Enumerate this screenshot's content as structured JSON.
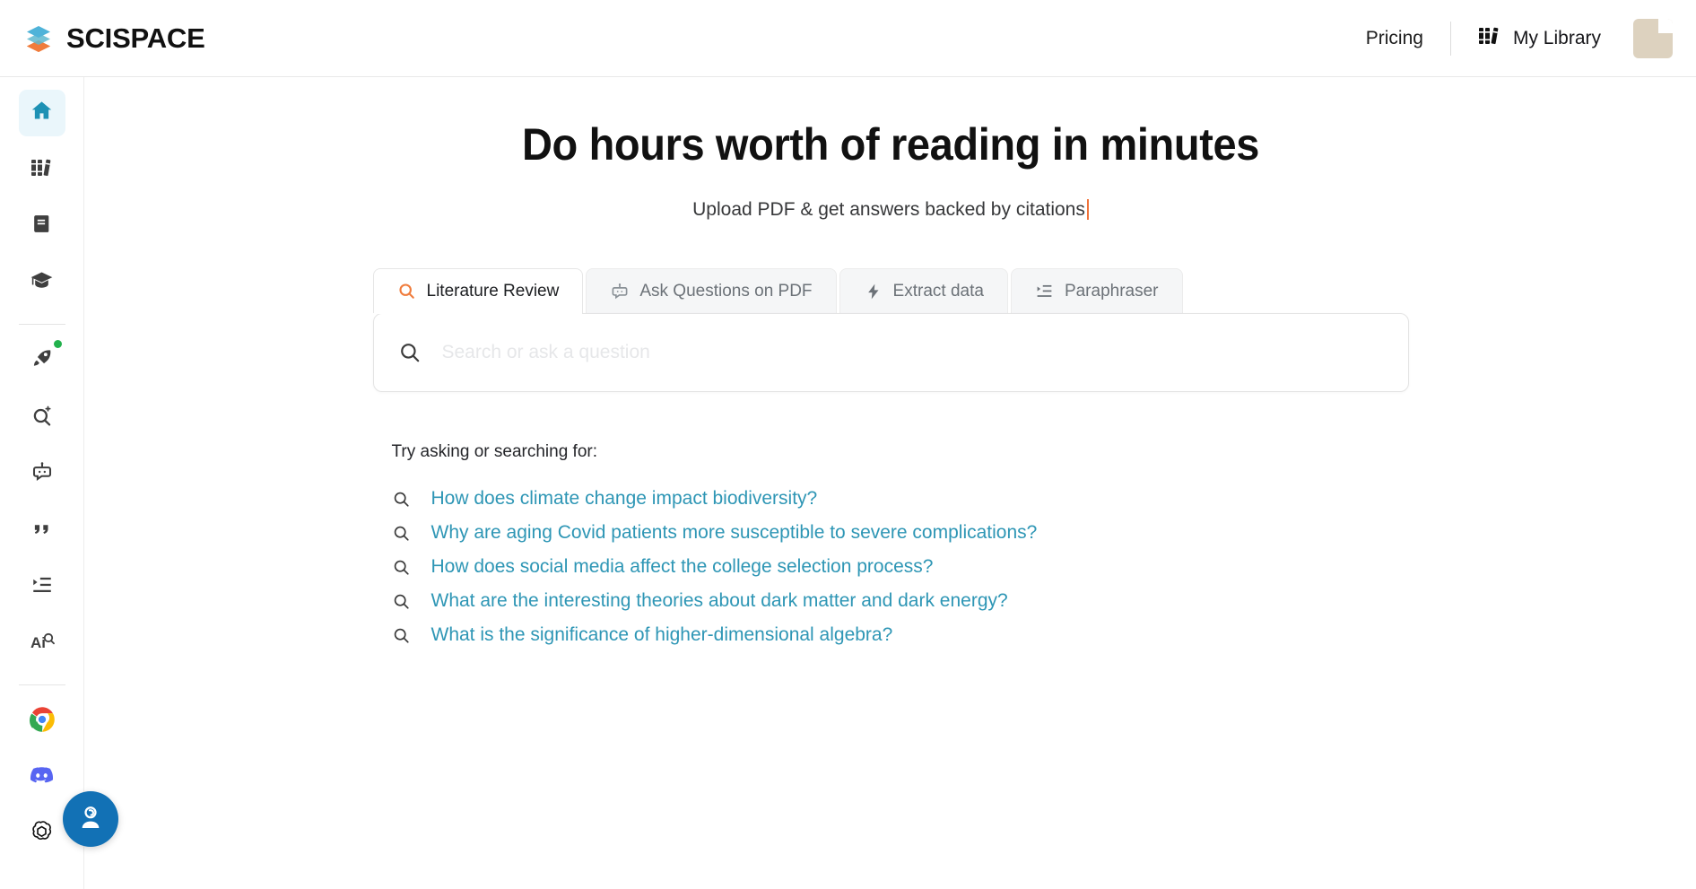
{
  "header": {
    "brand_name": "SCISPACE",
    "logo_icon": "layers-stack-icon",
    "pricing_label": "Pricing",
    "library_label": "My Library",
    "library_icon": "books-icon",
    "avatar_icon": "user-avatar",
    "avatar_color": "#ddd2bf"
  },
  "sidebar": {
    "items": [
      {
        "name": "home",
        "icon": "home-icon",
        "active": true,
        "badge": false
      },
      {
        "name": "library",
        "icon": "books-icon",
        "active": false,
        "badge": false
      },
      {
        "name": "notebook",
        "icon": "book-icon",
        "active": false,
        "badge": false
      },
      {
        "name": "scholar",
        "icon": "graduation-cap-icon",
        "active": false,
        "badge": false
      },
      {
        "name": "divider",
        "icon": "divider",
        "active": false,
        "badge": false
      },
      {
        "name": "launch",
        "icon": "rocket-icon",
        "active": false,
        "badge": true
      },
      {
        "name": "ai-search",
        "icon": "magnifier-sparkle-icon",
        "active": false,
        "badge": false
      },
      {
        "name": "chatbot",
        "icon": "chat-bot-icon",
        "active": false,
        "badge": false
      },
      {
        "name": "citation",
        "icon": "quote-icon",
        "active": false,
        "badge": false
      },
      {
        "name": "paraphraser",
        "icon": "indent-list-icon",
        "active": false,
        "badge": false
      },
      {
        "name": "ai-detector",
        "icon": "ai-detect-icon",
        "active": false,
        "badge": false
      },
      {
        "name": "divider2",
        "icon": "divider",
        "active": false,
        "badge": false
      },
      {
        "name": "chrome-extension",
        "icon": "chrome-icon",
        "active": false,
        "badge": false
      },
      {
        "name": "discord",
        "icon": "discord-icon",
        "active": false,
        "badge": false
      },
      {
        "name": "openai",
        "icon": "openai-icon",
        "active": false,
        "badge": false
      }
    ],
    "active_color": "#1d91b4",
    "active_bg": "#eaf6fb",
    "badge_color": "#22b14c"
  },
  "main": {
    "headline": "Do hours worth of reading in minutes",
    "subline": "Upload PDF & get answers backed by citations",
    "caret_color": "#f0733a"
  },
  "tabs": [
    {
      "label": "Literature Review",
      "icon": "search-icon",
      "active": true
    },
    {
      "label": "Ask Questions on PDF",
      "icon": "chat-bot-icon",
      "active": false
    },
    {
      "label": "Extract data",
      "icon": "lightning-bolt-icon",
      "active": false
    },
    {
      "label": "Paraphraser",
      "icon": "indent-list-icon",
      "active": false
    }
  ],
  "search": {
    "icon": "search-icon",
    "value": "",
    "placeholder": "Search or ask a question"
  },
  "suggestions": {
    "title": "Try asking or searching for:",
    "link_color": "#2e96b5",
    "items": [
      {
        "icon": "search-icon",
        "text": "How does climate change impact biodiversity?"
      },
      {
        "icon": "search-icon",
        "text": "Why are aging Covid patients more susceptible to severe complications?"
      },
      {
        "icon": "search-icon",
        "text": "How does social media affect the college selection process?"
      },
      {
        "icon": "search-icon",
        "text": "What are the interesting theories about dark matter and dark energy?"
      },
      {
        "icon": "search-icon",
        "text": "What is the significance of higher-dimensional algebra?"
      }
    ]
  },
  "support": {
    "icon": "support-agent-icon",
    "color": "#1271b5"
  }
}
